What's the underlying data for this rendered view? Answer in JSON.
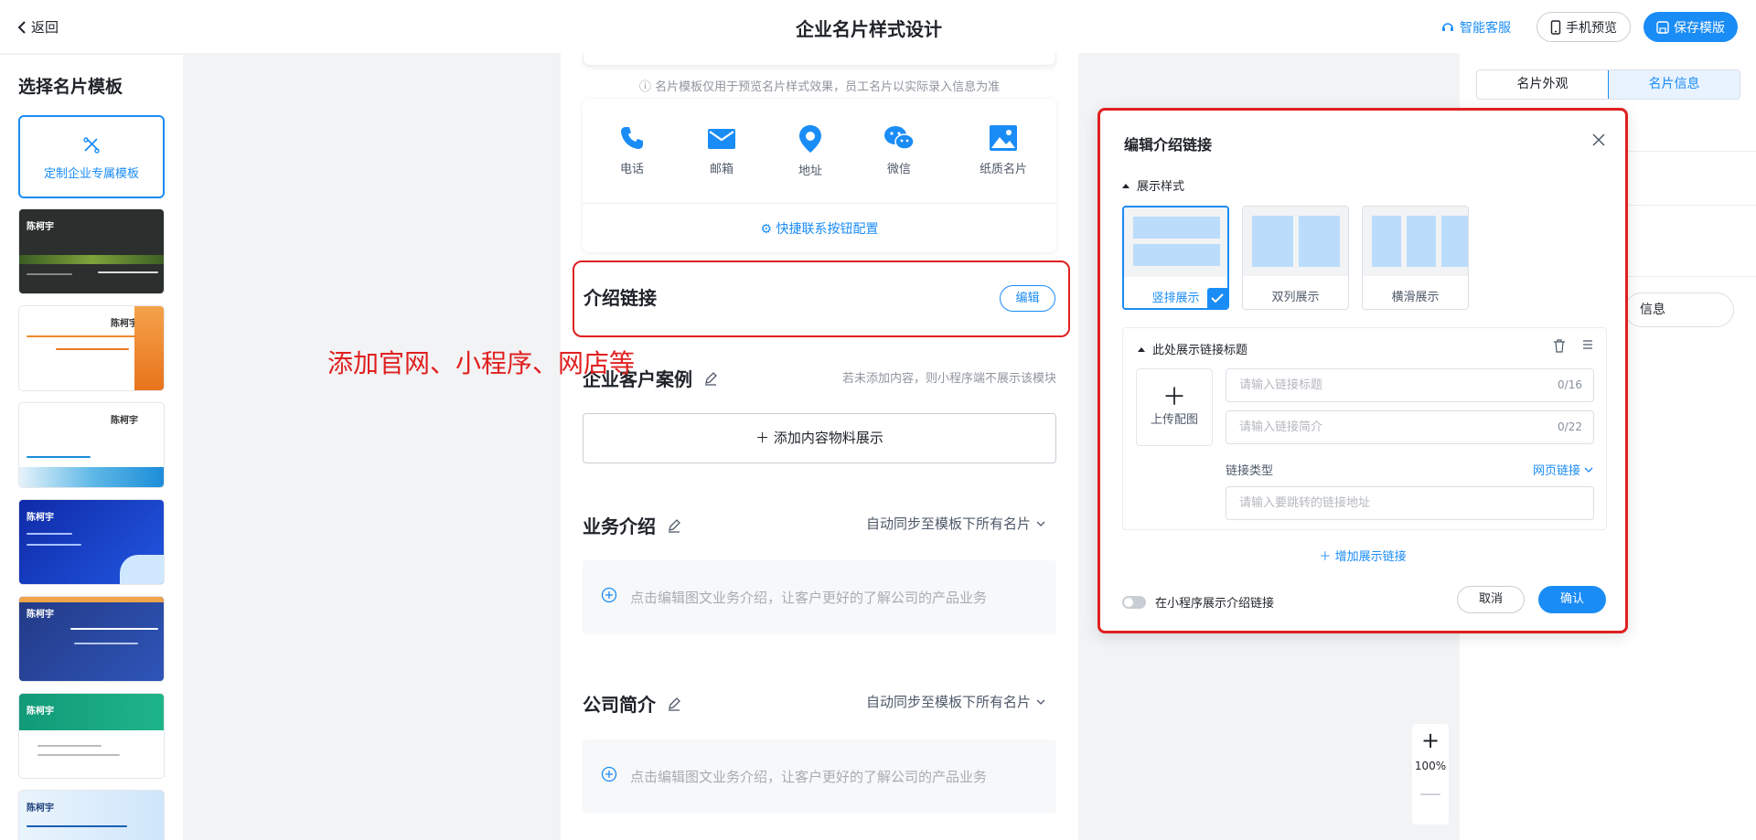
{
  "header": {
    "back_label": "返回",
    "title": "企业名片样式设计",
    "support_label": "智能客服",
    "preview_label": "手机预览",
    "save_label": "保存模版"
  },
  "left": {
    "title": "选择名片模板",
    "custom_template_label": "定制企业专属模板",
    "template_names": [
      "陈柯宇",
      "陈柯宇",
      "陈柯宇",
      "陈柯宇",
      "陈柯宇",
      "陈柯宇",
      "陈柯宇"
    ]
  },
  "phone": {
    "notice": "名片模板仅用于预览名片样式效果，员工名片以实际录入信息为准",
    "contacts": [
      {
        "label": "电话",
        "icon": "phone-icon"
      },
      {
        "label": "邮箱",
        "icon": "mail-icon"
      },
      {
        "label": "地址",
        "icon": "location-icon"
      },
      {
        "label": "微信",
        "icon": "wechat-icon"
      },
      {
        "label": "纸质名片",
        "icon": "image-icon"
      }
    ],
    "quick_config_label": "快捷联系按钮配置",
    "intro_link": {
      "title": "介绍链接",
      "edit_label": "编辑"
    },
    "clients": {
      "title": "企业客户案例",
      "hint": "若未添加内容，则小程序端不展示该模块",
      "add_label": "添加内容物料展示"
    },
    "business": {
      "title": "业务介绍",
      "sync_label": "自动同步至模板下所有名片",
      "placeholder": "点击编辑图文业务介绍，让客户更好的了解公司的产品业务"
    },
    "company": {
      "title": "公司简介",
      "sync_label": "自动同步至模板下所有名片",
      "placeholder": "点击编辑图文业务介绍，让客户更好的了解公司的产品业务"
    }
  },
  "annotation": "添加官网、小程序、网店等",
  "right": {
    "tabs": [
      "名片外观",
      "名片信息"
    ],
    "active_tab": 1,
    "partial_label": "信息"
  },
  "zoom": {
    "plus": "+",
    "value": "100%",
    "minus": "—"
  },
  "modal": {
    "title": "编辑介绍链接",
    "style_section": "展示样式",
    "layouts": [
      "竖排展示",
      "双列展示",
      "横滑展示"
    ],
    "selected_layout": 0,
    "link_title_section": "此处展示链接标题",
    "upload_label": "上传配图",
    "title_placeholder": "请输入链接标题",
    "title_count": "0/16",
    "desc_placeholder": "请输入链接简介",
    "desc_count": "0/22",
    "link_type_label": "链接类型",
    "link_type_value": "网页链接",
    "url_placeholder": "请输入要跳转的链接地址",
    "add_link_label": "增加展示链接",
    "toggle_label": "在小程序展示介绍链接",
    "cancel_label": "取消",
    "confirm_label": "确认"
  },
  "colors": {
    "primary": "#1a8cf5",
    "annotation": "#e02020"
  }
}
